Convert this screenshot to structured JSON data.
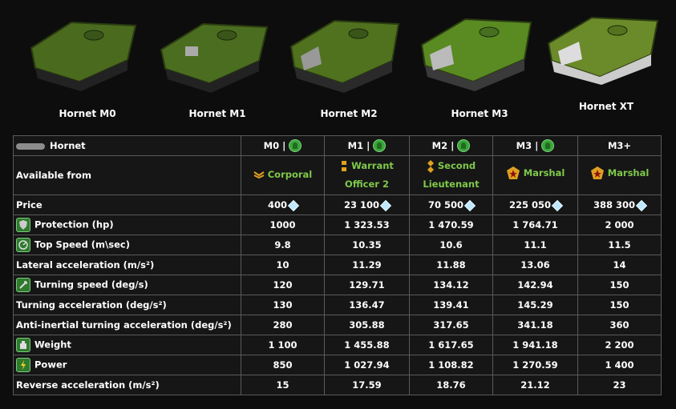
{
  "hulls": [
    {
      "name": "Hornet M0",
      "color": "#4a6a1e"
    },
    {
      "name": "Hornet M1",
      "color": "#4b6d20"
    },
    {
      "name": "Hornet M2",
      "color": "#50721f"
    },
    {
      "name": "Hornet M3",
      "color": "#5a8a22"
    },
    {
      "name": "Hornet XT",
      "color": "#6b8a2a"
    }
  ],
  "table": {
    "hull_label": "Hornet",
    "columns": [
      "M0 |",
      "M1 |",
      "M2 |",
      "M3 |",
      "M3+"
    ],
    "available_label": "Available from",
    "ranks": [
      {
        "name": "Corporal"
      },
      {
        "name": "Warrant Officer 2"
      },
      {
        "name": "Second Lieutenant"
      },
      {
        "name": "Marshal"
      },
      {
        "name": "Marshal"
      }
    ],
    "rows": [
      {
        "label": "Price",
        "icon": "",
        "values": [
          "400",
          "23 100",
          "70 500",
          "225 050",
          "388 300"
        ],
        "crystal": true
      },
      {
        "label": "Protection (hp)",
        "icon": "shield-icon",
        "values": [
          "1000",
          "1 323.53",
          "1 470.59",
          "1 764.71",
          "2 000"
        ]
      },
      {
        "label": "Top Speed (m\\sec)",
        "icon": "speedometer-icon",
        "values": [
          "9.8",
          "10.35",
          "10.6",
          "11.1",
          "11.5"
        ]
      },
      {
        "label": "Lateral acceleration (m/s²)",
        "icon": "",
        "values": [
          "10",
          "11.29",
          "11.88",
          "13.06",
          "14"
        ]
      },
      {
        "label": "Turning speed (deg/s)",
        "icon": "turning-icon",
        "values": [
          "120",
          "129.71",
          "134.12",
          "142.94",
          "150"
        ]
      },
      {
        "label": "Turning acceleration (deg/s²)",
        "icon": "",
        "values": [
          "130",
          "136.47",
          "139.41",
          "145.29",
          "150"
        ]
      },
      {
        "label": "Anti-inertial turning acceleration (deg/s²)",
        "icon": "",
        "values": [
          "280",
          "305.88",
          "317.65",
          "341.18",
          "360"
        ]
      },
      {
        "label": "Weight",
        "icon": "weight-icon",
        "values": [
          "1 100",
          "1 455.88",
          "1 617.65",
          "1 941.18",
          "2 200"
        ]
      },
      {
        "label": "Power",
        "icon": "lightning-icon",
        "values": [
          "850",
          "1 027.94",
          "1 108.82",
          "1 270.59",
          "1 400"
        ]
      },
      {
        "label": "Reverse acceleration (m/s²)",
        "icon": "",
        "values": [
          "15",
          "17.59",
          "18.76",
          "21.12",
          "23"
        ]
      }
    ]
  },
  "colors": {
    "rank_green": "#7fc94a",
    "border": "#5a5a5a",
    "cell_bg": "#161616"
  }
}
